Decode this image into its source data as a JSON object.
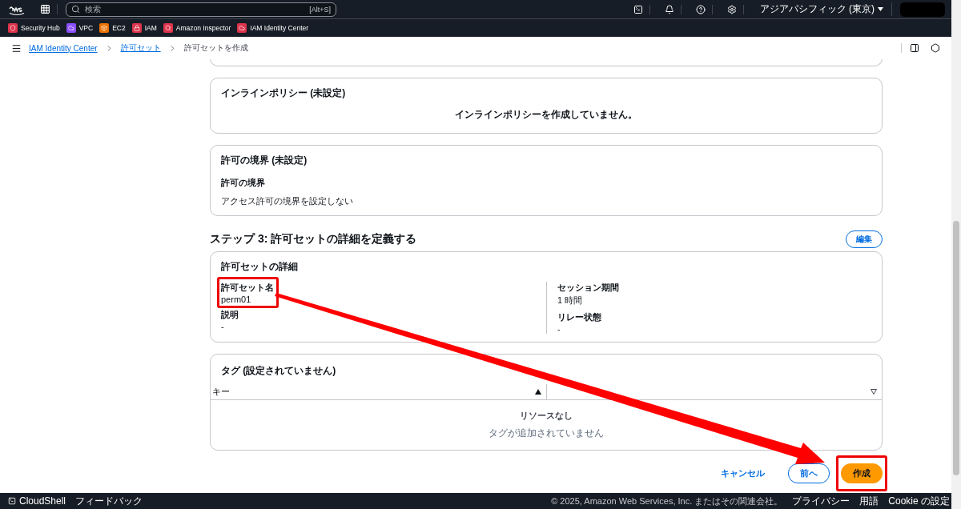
{
  "top_nav": {
    "search": {
      "placeholder": "検索",
      "shortcut": "[Alt+S]"
    },
    "region": "アジアパシフィック (東京)"
  },
  "favorites": [
    {
      "label": "Security Hub",
      "color": "#dd344c"
    },
    {
      "label": "VPC",
      "color": "#8c4fff"
    },
    {
      "label": "EC2",
      "color": "#ed7100"
    },
    {
      "label": "IAM",
      "color": "#dd344c"
    },
    {
      "label": "Amazon Inspector",
      "color": "#dd344c"
    },
    {
      "label": "IAM Identity Center",
      "color": "#dd344c"
    }
  ],
  "breadcrumbs": [
    {
      "label": "IAM Identity Center",
      "link": true
    },
    {
      "label": "許可セット",
      "link": true
    },
    {
      "label": "許可セットを作成",
      "link": false
    }
  ],
  "inline_policy": {
    "title": "インラインポリシー (未設定)",
    "message": "インラインポリシーを作成していません。"
  },
  "boundary": {
    "title": "許可の境界 (未設定)",
    "label": "許可の境界",
    "value": "アクセス許可の境界を設定しない"
  },
  "step3": {
    "heading": "ステップ 3: 許可セットの詳細を定義する",
    "edit_button": "編集",
    "details": {
      "title": "許可セットの詳細",
      "columns": [
        [
          {
            "label": "許可セット名",
            "value": "perm01"
          },
          {
            "label": "説明",
            "value": "-"
          }
        ],
        [
          {
            "label": "セッション期間",
            "value": "1 時間"
          },
          {
            "label": "リレー状態",
            "value": "-"
          }
        ]
      ]
    }
  },
  "tags": {
    "title": "タグ (設定されていません)",
    "columns": [
      {
        "label": "キー",
        "sorted": true
      },
      {
        "sorted": false
      }
    ],
    "empty_title": "リソースなし",
    "empty_message": "タグが追加されていません"
  },
  "actions": [
    {
      "label": "キャンセル",
      "kind": "link"
    },
    {
      "label": "前へ",
      "kind": "normal"
    },
    {
      "label": "作成",
      "kind": "primary"
    }
  ],
  "footer": {
    "cloudshell": "CloudShell",
    "feedback": "フィードバック",
    "copyright": "© 2025, Amazon Web Services, Inc. またはその関連会社。",
    "links": [
      "プライバシー",
      "用語",
      "Cookie の設定"
    ]
  }
}
